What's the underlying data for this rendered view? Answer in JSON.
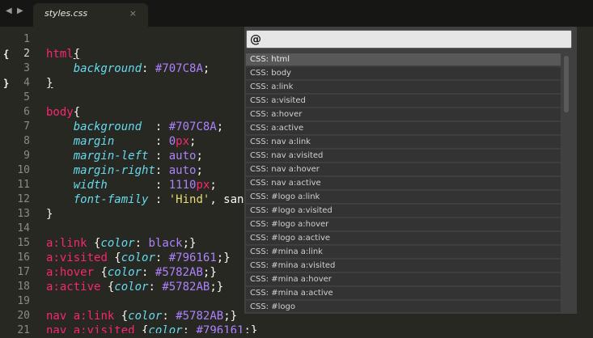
{
  "tab": {
    "title": "styles.css",
    "close": "×",
    "back": "◀",
    "forward": "▶"
  },
  "gutter": {
    "line_numbers": [
      "1",
      "2",
      "3",
      "4",
      "5",
      "6",
      "7",
      "8",
      "9",
      "10",
      "11",
      "12",
      "13",
      "14",
      "15",
      "16",
      "17",
      "18",
      "19",
      "20",
      "21"
    ],
    "active_line": "2",
    "fold_open": "{",
    "fold_close": "}"
  },
  "code": [
    [],
    [
      {
        "t": "html",
        "c": "sel"
      },
      {
        "t": "{",
        "c": "br"
      }
    ],
    [
      {
        "t": "    "
      },
      {
        "t": "background",
        "c": "prop"
      },
      {
        "t": ": "
      },
      {
        "t": "#707C8A",
        "c": "val"
      },
      {
        "t": ";"
      }
    ],
    [
      {
        "t": "}",
        "c": "br"
      }
    ],
    [],
    [
      {
        "t": "body",
        "c": "sel"
      },
      {
        "t": "{"
      }
    ],
    [
      {
        "t": "    "
      },
      {
        "t": "background",
        "c": "prop"
      },
      {
        "t": "  : "
      },
      {
        "t": "#707C8A",
        "c": "val"
      },
      {
        "t": ";"
      }
    ],
    [
      {
        "t": "    "
      },
      {
        "t": "margin",
        "c": "prop"
      },
      {
        "t": "      : "
      },
      {
        "t": "0",
        "c": "val"
      },
      {
        "t": "px",
        "c": "unit"
      },
      {
        "t": ";"
      }
    ],
    [
      {
        "t": "    "
      },
      {
        "t": "margin-left",
        "c": "prop"
      },
      {
        "t": " : "
      },
      {
        "t": "auto",
        "c": "val"
      },
      {
        "t": ";"
      }
    ],
    [
      {
        "t": "    "
      },
      {
        "t": "margin-right",
        "c": "prop"
      },
      {
        "t": ": "
      },
      {
        "t": "auto",
        "c": "val"
      },
      {
        "t": ";"
      }
    ],
    [
      {
        "t": "    "
      },
      {
        "t": "width",
        "c": "prop"
      },
      {
        "t": "       : "
      },
      {
        "t": "1110",
        "c": "val"
      },
      {
        "t": "px",
        "c": "unit"
      },
      {
        "t": ";"
      }
    ],
    [
      {
        "t": "    "
      },
      {
        "t": "font-family",
        "c": "prop"
      },
      {
        "t": " : "
      },
      {
        "t": "'Hind'",
        "c": "str"
      },
      {
        "t": ", sans-"
      }
    ],
    [
      {
        "t": "}"
      }
    ],
    [],
    [
      {
        "t": "a",
        "c": "sel"
      },
      {
        "t": ":link",
        "c": "sel"
      },
      {
        "t": " {"
      },
      {
        "t": "color",
        "c": "prop"
      },
      {
        "t": ": "
      },
      {
        "t": "black",
        "c": "val"
      },
      {
        "t": ";}"
      }
    ],
    [
      {
        "t": "a",
        "c": "sel"
      },
      {
        "t": ":visited",
        "c": "sel"
      },
      {
        "t": " {"
      },
      {
        "t": "color",
        "c": "prop"
      },
      {
        "t": ": "
      },
      {
        "t": "#796161",
        "c": "val"
      },
      {
        "t": ";}"
      }
    ],
    [
      {
        "t": "a",
        "c": "sel"
      },
      {
        "t": ":hover",
        "c": "sel"
      },
      {
        "t": " {"
      },
      {
        "t": "color",
        "c": "prop"
      },
      {
        "t": ": "
      },
      {
        "t": "#5782AB",
        "c": "val"
      },
      {
        "t": ";}"
      }
    ],
    [
      {
        "t": "a",
        "c": "sel"
      },
      {
        "t": ":active",
        "c": "sel"
      },
      {
        "t": " {"
      },
      {
        "t": "color",
        "c": "prop"
      },
      {
        "t": ": "
      },
      {
        "t": "#5782AB",
        "c": "val"
      },
      {
        "t": ";}"
      }
    ],
    [],
    [
      {
        "t": "nav ",
        "c": "sel"
      },
      {
        "t": "a",
        "c": "sel"
      },
      {
        "t": ":link",
        "c": "sel"
      },
      {
        "t": " {"
      },
      {
        "t": "color",
        "c": "prop"
      },
      {
        "t": ": "
      },
      {
        "t": "#5782AB",
        "c": "val"
      },
      {
        "t": ";}"
      }
    ],
    [
      {
        "t": "nav ",
        "c": "sel"
      },
      {
        "t": "a",
        "c": "sel"
      },
      {
        "t": ":visited",
        "c": "sel"
      },
      {
        "t": " {"
      },
      {
        "t": "color",
        "c": "prop"
      },
      {
        "t": ": "
      },
      {
        "t": "#796161",
        "c": "val"
      },
      {
        "t": ";}"
      }
    ]
  ],
  "symbol_panel": {
    "query": "@",
    "results": [
      "CSS: html",
      "CSS: body",
      "CSS: a:link",
      "CSS: a:visited",
      "CSS: a:hover",
      "CSS: a:active",
      "CSS: nav a:link",
      "CSS: nav a:visited",
      "CSS: nav a:hover",
      "CSS: nav a:active",
      "CSS: #logo a:link",
      "CSS: #logo a:visited",
      "CSS: #logo a:hover",
      "CSS: #logo a:active",
      "CSS: #mina a:link",
      "CSS: #mina a:visited",
      "CSS: #mina a:hover",
      "CSS: #mina a:active",
      "CSS: #logo"
    ],
    "selected_index": 0
  },
  "colors": {
    "editor_bg": "#272822",
    "tabbar_bg": "#161714",
    "selector": "#f92672",
    "property": "#66d9ef",
    "value": "#ae81ff",
    "string": "#e6db74",
    "panel_bg": "#404040",
    "selected_row": "#585858"
  }
}
